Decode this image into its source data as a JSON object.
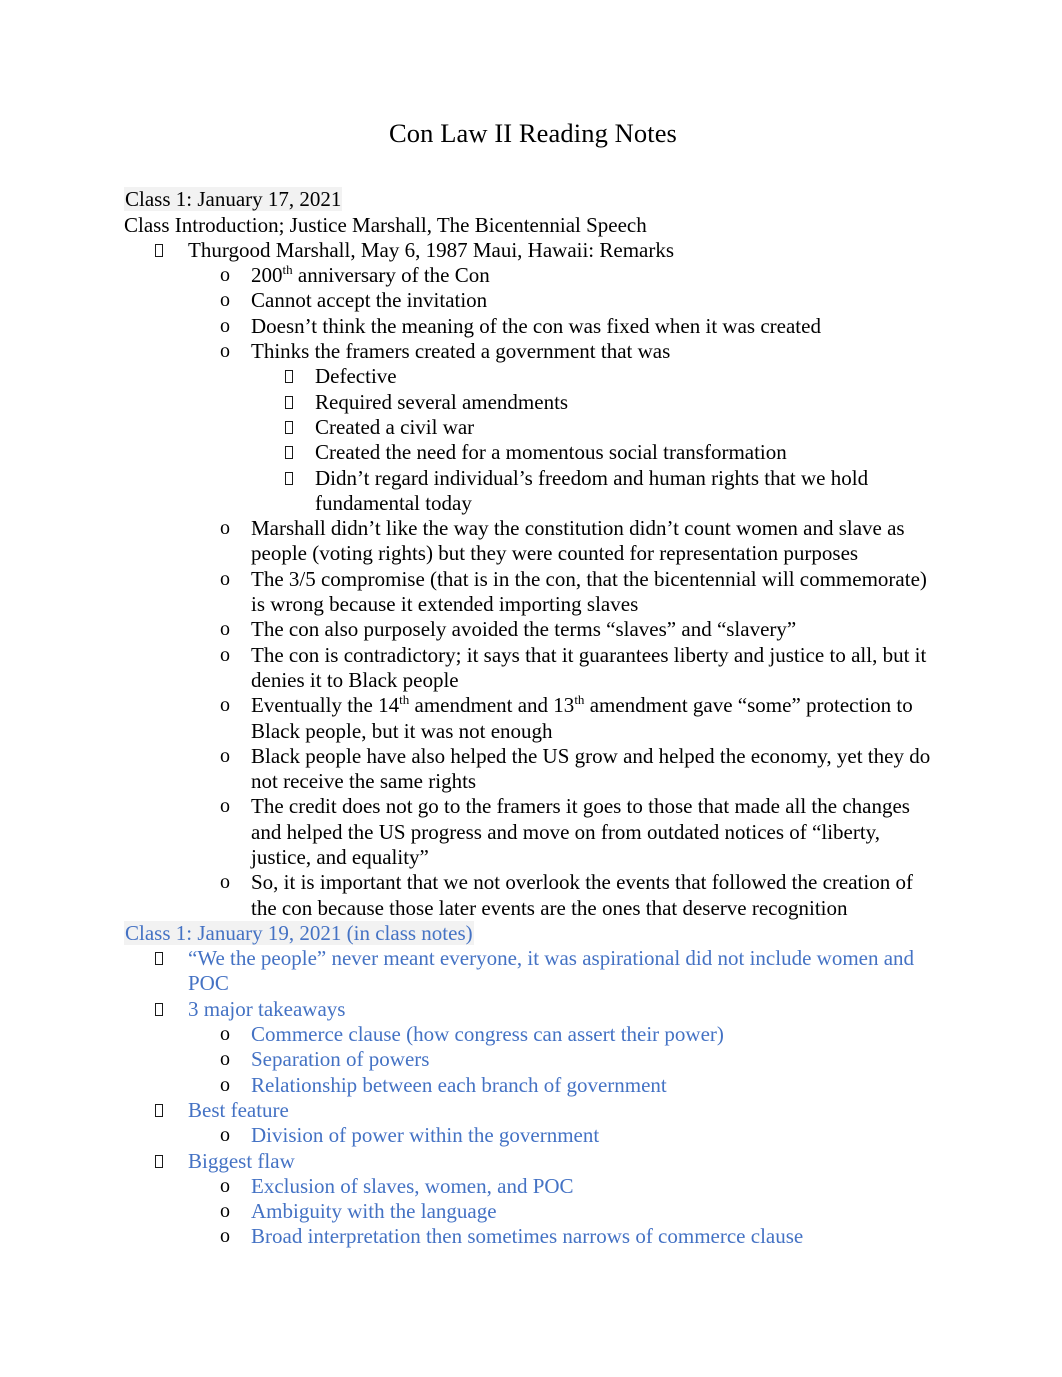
{
  "document": {
    "title": "Con Law II Reading Notes",
    "colors": {
      "body_text": "#000000",
      "accent_blue": "#4472C4",
      "heading_highlight": "#F2F2F2",
      "page_background": "#FFFFFF"
    },
    "markers": {
      "level1": "missing-glyph-box",
      "level2": "o",
      "level3": "missing-glyph-box"
    }
  },
  "sections": [
    {
      "heading": "Class 1: January 17, 2021",
      "subheading": "Class Introduction; Justice Marshall, The Bicentennial Speech",
      "color": "#000000"
    },
    {
      "heading": "Class 1: January 19, 2021 (in class notes)",
      "color": "#4472C4"
    }
  ],
  "section1": {
    "heading": "Class 1: January 17, 2021",
    "subheading": "Class Introduction; Justice Marshall, The Bicentennial Speech",
    "l1_0": "Thurgood Marshall, May 6, 1987 Maui, Hawaii: Remarks",
    "items": {
      "a0_pre": "200",
      "a0_sup": "th",
      "a0_post": " anniversary of the Con",
      "a1": "Cannot accept the invitation",
      "a2": "Doesn’t think the meaning of the con was fixed when it was created",
      "a3": "Thinks the framers created a government that was",
      "b0": "Defective",
      "b1": "Required several amendments",
      "b2": "Created a civil war",
      "b3": "Created the need for a momentous social transformation",
      "b4": "Didn’t regard individual’s freedom and human rights that we hold fundamental today",
      "a4": "Marshall didn’t like the way the constitution didn’t count women and slave as people (voting rights) but they were counted for representation purposes",
      "a5": "The 3/5 compromise (that is in the con, that the bicentennial will commemorate) is wrong because it extended importing slaves",
      "a6": "The con also purposely avoided the terms “slaves” and “slavery”",
      "a7": "The con is contradictory; it says that it guarantees liberty and justice to all, but it denies it to Black people",
      "a8_pre": "Eventually the 14",
      "a8_sup1": "th",
      "a8_mid": " amendment and 13",
      "a8_sup2": "th",
      "a8_post": " amendment gave “some” protection to Black people, but it was not enough",
      "a9": "Black people have also helped the US grow and helped the economy, yet they do not receive the same rights",
      "a10": "The credit does not go to the framers it goes to those that made all the changes and helped the US progress and move on from outdated notices of “liberty, justice, and equality”",
      "a11": "So, it is important that we not overlook the events that followed the creation of the con because those later events are the ones that deserve recognition"
    }
  },
  "section2": {
    "heading": "Class 1: January 19, 2021 (in class notes)",
    "items": {
      "c0": "“We the people” never meant everyone, it was aspirational did not include women and POC",
      "c1": "3 major takeaways",
      "d0": "Commerce clause (how congress can assert their power)",
      "d1": "Separation of powers",
      "d2": "Relationship between each branch of government",
      "c2": "Best feature",
      "e0": "Division of power within the government",
      "c3": "Biggest flaw",
      "f0": "Exclusion of slaves, women, and POC",
      "f1": "Ambiguity with the language",
      "f2": "Broad interpretation then sometimes narrows of commerce clause"
    }
  }
}
